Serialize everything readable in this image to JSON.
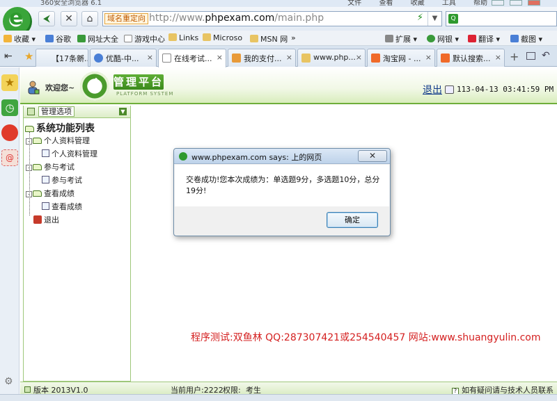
{
  "browser": {
    "title": "360安全浏览器 6.1",
    "menus": [
      "文件",
      "查看",
      "收藏",
      "工具",
      "帮助"
    ],
    "redirect_badge": "域名重定向",
    "url_prefix": "http://www.",
    "url_domain": "phpexam.com",
    "url_path": "/main.php",
    "bookmarks": [
      "收藏",
      "谷歌",
      "网址大全",
      "游戏中心",
      "Links",
      "Microso",
      "MSN 网"
    ],
    "bookmark_more": "»",
    "tools": [
      "扩展",
      "网银",
      "翻译",
      "截图"
    ],
    "tabs": [
      {
        "label": "【17条新...",
        "close": "×"
      },
      {
        "label": "优酷-中...",
        "close": "×"
      },
      {
        "label": "在线考试...",
        "close": "×"
      },
      {
        "label": "我的支付...",
        "close": "×"
      },
      {
        "label": "www.php...",
        "close": "×"
      },
      {
        "label": "淘宝网 - ...",
        "close": "×"
      },
      {
        "label": "默认搜索...",
        "close": "×"
      }
    ],
    "new_tab": "+"
  },
  "app": {
    "welcome": "欢迎您~",
    "brand": "管理平台",
    "brand_sub": "PLATFORM SYSTEM",
    "logout": "退出",
    "datetime": "113-04-13 03:41:59 PM"
  },
  "sidebar": {
    "header": "管理选项",
    "title": "系统功能列表",
    "groups": [
      {
        "label": "个人资料管理",
        "child": "个人资料管理"
      },
      {
        "label": "参与考试",
        "child": "参与考试"
      },
      {
        "label": "查看成绩",
        "child": "查看成绩"
      }
    ],
    "exit": "退出",
    "expand_glyph": "-"
  },
  "main": {
    "credits": "程序测试:双鱼林 QQ:287307421或254540457 网站:www.shuangyulin.com"
  },
  "status": {
    "version": "版本 2013V1.0",
    "current_user": "当前用户:2222",
    "permission": "权限:",
    "role": "考生",
    "help": "如有疑问请与技术人员联系"
  },
  "dialog": {
    "title": "www.phpexam.com says: 上的网页",
    "message": "交卷成功!您本次成绩为：单选题9分，多选题10分，总分19分!",
    "ok": "确定",
    "close": "✕"
  },
  "colors": {
    "accent_green": "#6fae3a",
    "credits_red": "#d42020",
    "link_blue": "#113a8a"
  }
}
